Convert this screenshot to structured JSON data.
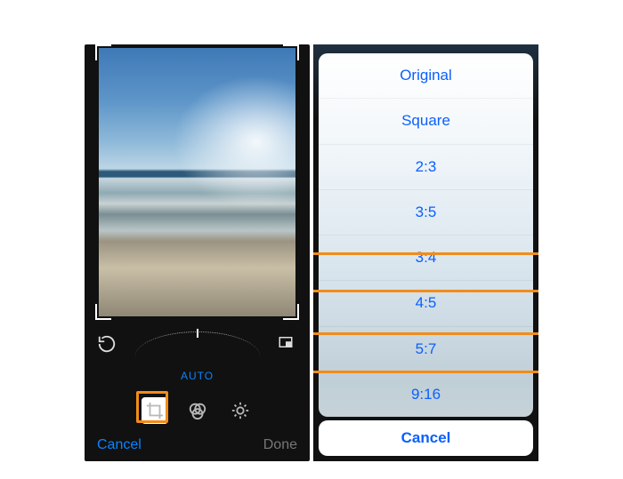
{
  "left": {
    "auto_label": "AUTO",
    "bottom": {
      "cancel": "Cancel",
      "done": "Done"
    },
    "icons": {
      "rotate": "rotate-ccw-icon",
      "aspect": "aspect-ratio-icon",
      "crop": "crop-icon",
      "filters": "filters-icon",
      "adjust": "adjust-icon"
    }
  },
  "right": {
    "options": [
      "Original",
      "Square",
      "2:3",
      "3:5",
      "3:4",
      "4:5",
      "5:7",
      "9:16"
    ],
    "cancel": "Cancel",
    "highlighted": [
      "4:5",
      "9:16"
    ]
  },
  "colors": {
    "ios_blue": "#0a60ff",
    "highlight_orange": "#f28c1a"
  }
}
